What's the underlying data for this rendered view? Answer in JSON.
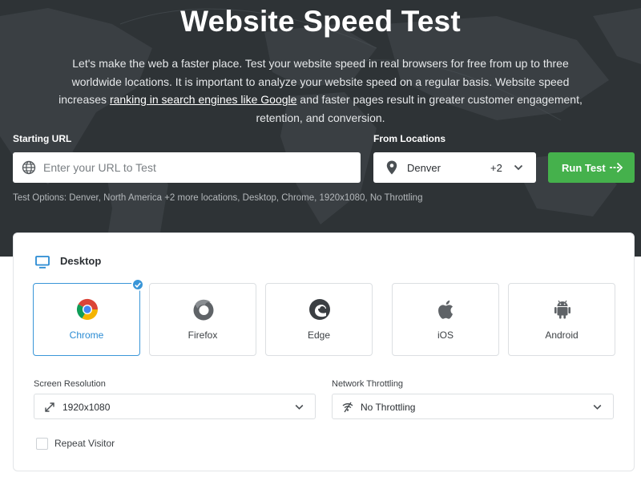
{
  "hero": {
    "title": "Website Speed Test",
    "intro_before_link": "Let's make the web a faster place. Test your website speed in real browsers for free from up to three worldwide locations. It is important to analyze your website speed on a regular basis. Website speed increases ",
    "intro_link": "ranking in search engines like Google",
    "intro_after_link": " and faster pages result in greater customer engagement, retention, and conversion."
  },
  "form": {
    "url_label": "Starting URL",
    "url_placeholder": "Enter your URL to Test",
    "locations_label": "From Locations",
    "location_value": "Denver",
    "location_more": "+2",
    "run_label": "Run Test",
    "test_options": "Test Options: Denver, North America +2 more locations, Desktop, Chrome, 1920x1080, No Throttling"
  },
  "panel": {
    "device_label": "Desktop",
    "browsers": [
      {
        "name": "Chrome",
        "icon": "chrome-icon",
        "selected": true
      },
      {
        "name": "Firefox",
        "icon": "firefox-icon",
        "selected": false
      },
      {
        "name": "Edge",
        "icon": "edge-icon",
        "selected": false
      },
      {
        "name": "iOS",
        "icon": "apple-icon",
        "selected": false
      },
      {
        "name": "Android",
        "icon": "android-icon",
        "selected": false
      }
    ],
    "resolution_label": "Screen Resolution",
    "resolution_value": "1920x1080",
    "throttling_label": "Network Throttling",
    "throttling_value": "No Throttling",
    "repeat_visitor_label": "Repeat Visitor",
    "repeat_visitor_checked": false
  },
  "colors": {
    "hero_bg": "#2e3336",
    "run_button": "#45b14c",
    "accent_blue": "#3a96d8"
  }
}
